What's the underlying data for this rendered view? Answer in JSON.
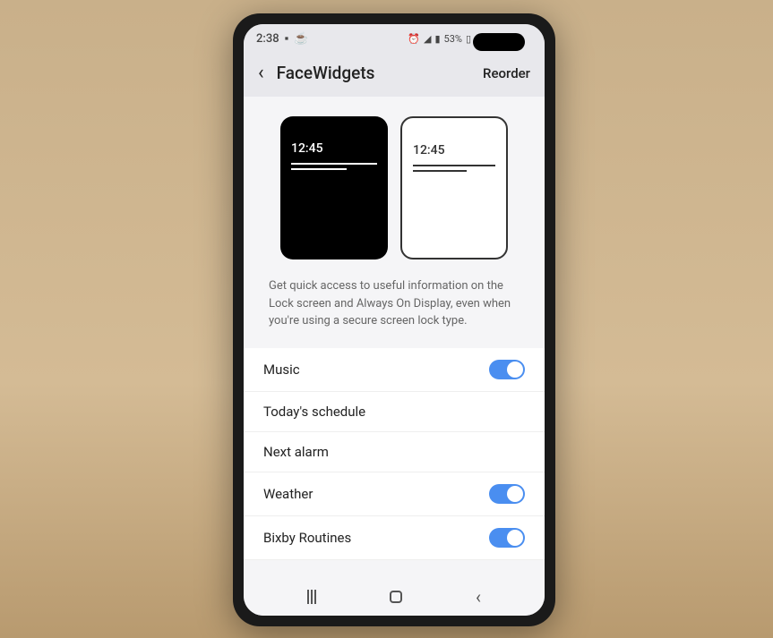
{
  "status_bar": {
    "time": "2:38",
    "battery": "53%"
  },
  "header": {
    "title": "FaceWidgets",
    "action": "Reorder"
  },
  "preview": {
    "time": "12:45"
  },
  "description": "Get quick access to useful information on the Lock screen and Always On Display, even when you're using a secure screen lock type.",
  "settings": [
    {
      "label": "Music",
      "enabled": true
    },
    {
      "label": "Today's schedule",
      "enabled": null
    },
    {
      "label": "Next alarm",
      "enabled": null
    },
    {
      "label": "Weather",
      "enabled": true
    },
    {
      "label": "Bixby Routines",
      "enabled": true
    }
  ]
}
